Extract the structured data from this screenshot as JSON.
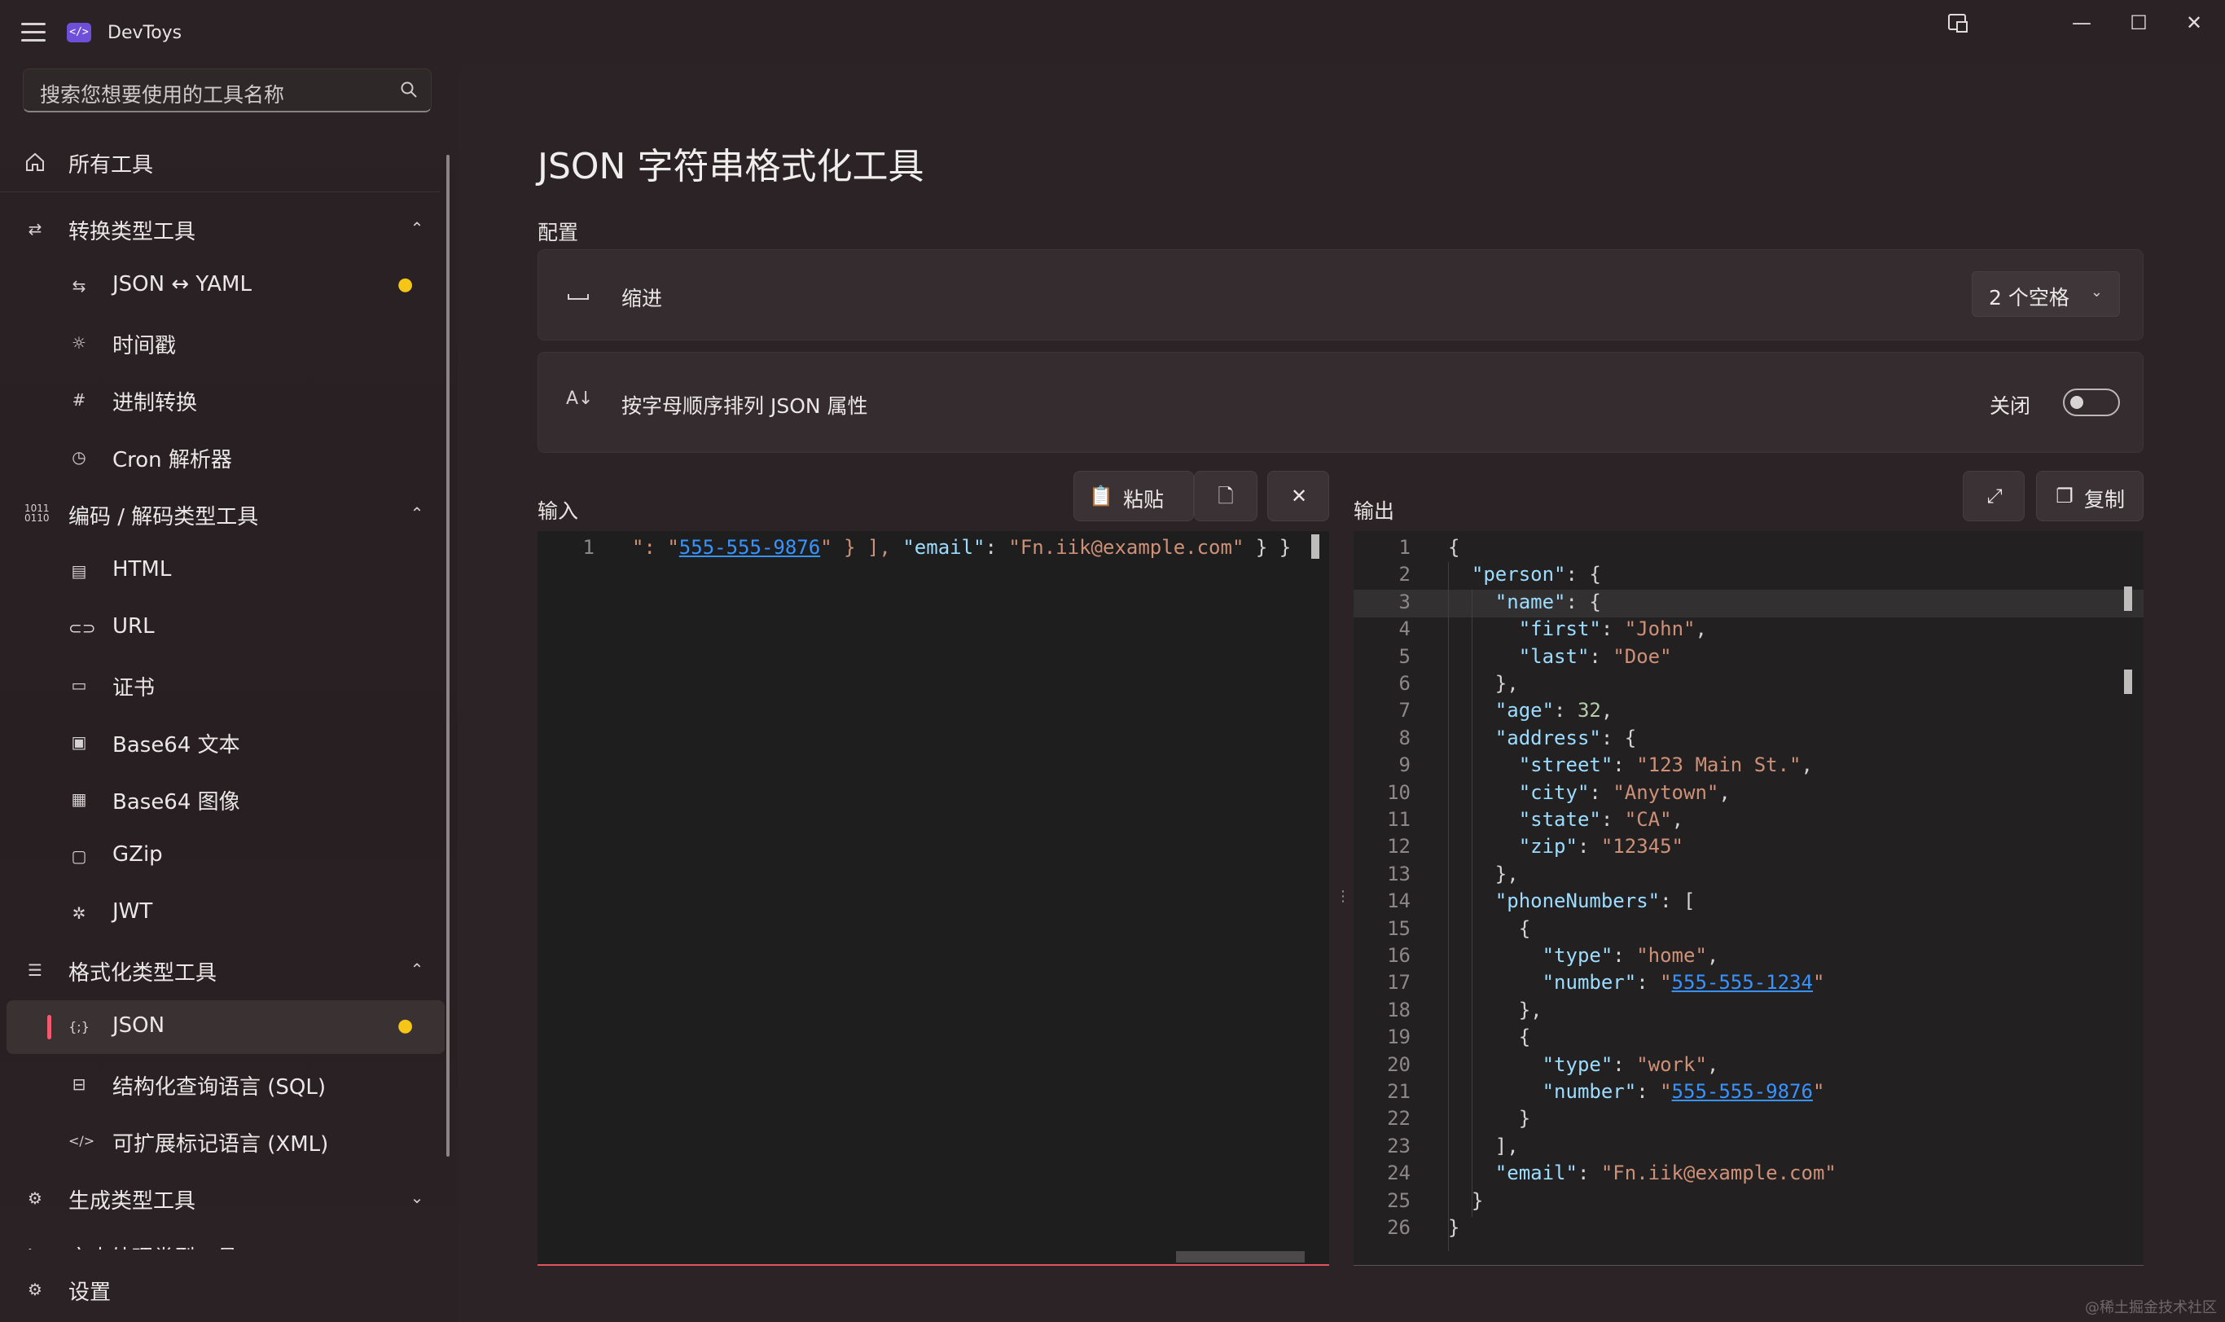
{
  "app": {
    "title": "DevToys",
    "logo_glyph": "</>"
  },
  "window_controls": {
    "snap_icon": "snap-layout-icon",
    "minimize": "—",
    "maximize": "☐",
    "close": "✕"
  },
  "sidebar": {
    "search_placeholder": "搜索您想要使用的工具名称",
    "all_tools": "所有工具",
    "groups": [
      {
        "label": "转换类型工具",
        "expanded": true,
        "items": [
          {
            "label": "JSON ↔ YAML",
            "badge": "bulb"
          },
          {
            "label": "时间戳"
          },
          {
            "label": "进制转换"
          },
          {
            "label": "Cron 解析器"
          }
        ]
      },
      {
        "label": "编码 / 解码类型工具",
        "expanded": true,
        "items": [
          {
            "label": "HTML"
          },
          {
            "label": "URL"
          },
          {
            "label": "证书"
          },
          {
            "label": "Base64 文本"
          },
          {
            "label": "Base64 图像"
          },
          {
            "label": "GZip"
          },
          {
            "label": "JWT"
          }
        ]
      },
      {
        "label": "格式化类型工具",
        "expanded": true,
        "items": [
          {
            "label": "JSON",
            "badge": "bulb",
            "selected": true
          },
          {
            "label": "结构化查询语言 (SQL)"
          },
          {
            "label": "可扩展标记语言 (XML)"
          }
        ]
      },
      {
        "label": "生成类型工具",
        "expanded": false
      },
      {
        "label": "文本处理类型工具",
        "expanded": false
      }
    ],
    "settings": "设置"
  },
  "page": {
    "title": "JSON 字符串格式化工具",
    "config_label": "配置",
    "indent": {
      "label": "缩进",
      "value": "2 个空格"
    },
    "sort": {
      "label": "按字母顺序排列 JSON 属性",
      "state_label": "关闭",
      "on": false
    }
  },
  "input": {
    "label": "输入",
    "paste_label": "粘贴",
    "line_number": "1",
    "line_text_1": "\": \"",
    "line_url": "555-555-9876",
    "line_text_2": "\" } ], ",
    "line_key": "\"email\"",
    "line_text_3": ": ",
    "line_value": "\"Fn.iik@example.com\"",
    "line_text_4": " } }"
  },
  "output": {
    "label": "输出",
    "copy_label": "复制",
    "lines": [
      [
        {
          "t": "{",
          "c": "p"
        }
      ],
      [
        {
          "t": "  ",
          "c": "p"
        },
        {
          "t": "\"person\"",
          "c": "k"
        },
        {
          "t": ": {",
          "c": "p"
        }
      ],
      [
        {
          "t": "    ",
          "c": "p"
        },
        {
          "t": "\"name\"",
          "c": "k"
        },
        {
          "t": ": {",
          "c": "p"
        }
      ],
      [
        {
          "t": "      ",
          "c": "p"
        },
        {
          "t": "\"first\"",
          "c": "k"
        },
        {
          "t": ": ",
          "c": "p"
        },
        {
          "t": "\"John\"",
          "c": "s"
        },
        {
          "t": ",",
          "c": "p"
        }
      ],
      [
        {
          "t": "      ",
          "c": "p"
        },
        {
          "t": "\"last\"",
          "c": "k"
        },
        {
          "t": ": ",
          "c": "p"
        },
        {
          "t": "\"Doe\"",
          "c": "s"
        }
      ],
      [
        {
          "t": "    },",
          "c": "p"
        }
      ],
      [
        {
          "t": "    ",
          "c": "p"
        },
        {
          "t": "\"age\"",
          "c": "k"
        },
        {
          "t": ": ",
          "c": "p"
        },
        {
          "t": "32",
          "c": "n"
        },
        {
          "t": ",",
          "c": "p"
        }
      ],
      [
        {
          "t": "    ",
          "c": "p"
        },
        {
          "t": "\"address\"",
          "c": "k"
        },
        {
          "t": ": {",
          "c": "p"
        }
      ],
      [
        {
          "t": "      ",
          "c": "p"
        },
        {
          "t": "\"street\"",
          "c": "k"
        },
        {
          "t": ": ",
          "c": "p"
        },
        {
          "t": "\"123 Main St.\"",
          "c": "s"
        },
        {
          "t": ",",
          "c": "p"
        }
      ],
      [
        {
          "t": "      ",
          "c": "p"
        },
        {
          "t": "\"city\"",
          "c": "k"
        },
        {
          "t": ": ",
          "c": "p"
        },
        {
          "t": "\"Anytown\"",
          "c": "s"
        },
        {
          "t": ",",
          "c": "p"
        }
      ],
      [
        {
          "t": "      ",
          "c": "p"
        },
        {
          "t": "\"state\"",
          "c": "k"
        },
        {
          "t": ": ",
          "c": "p"
        },
        {
          "t": "\"CA\"",
          "c": "s"
        },
        {
          "t": ",",
          "c": "p"
        }
      ],
      [
        {
          "t": "      ",
          "c": "p"
        },
        {
          "t": "\"zip\"",
          "c": "k"
        },
        {
          "t": ": ",
          "c": "p"
        },
        {
          "t": "\"12345\"",
          "c": "s"
        }
      ],
      [
        {
          "t": "    },",
          "c": "p"
        }
      ],
      [
        {
          "t": "    ",
          "c": "p"
        },
        {
          "t": "\"phoneNumbers\"",
          "c": "k"
        },
        {
          "t": ": [",
          "c": "p"
        }
      ],
      [
        {
          "t": "      {",
          "c": "p"
        }
      ],
      [
        {
          "t": "        ",
          "c": "p"
        },
        {
          "t": "\"type\"",
          "c": "k"
        },
        {
          "t": ": ",
          "c": "p"
        },
        {
          "t": "\"home\"",
          "c": "s"
        },
        {
          "t": ",",
          "c": "p"
        }
      ],
      [
        {
          "t": "        ",
          "c": "p"
        },
        {
          "t": "\"number\"",
          "c": "k"
        },
        {
          "t": ": ",
          "c": "p"
        },
        {
          "t": "\"",
          "c": "s"
        },
        {
          "t": "555-555-1234",
          "c": "u"
        },
        {
          "t": "\"",
          "c": "s"
        }
      ],
      [
        {
          "t": "      },",
          "c": "p"
        }
      ],
      [
        {
          "t": "      {",
          "c": "p"
        }
      ],
      [
        {
          "t": "        ",
          "c": "p"
        },
        {
          "t": "\"type\"",
          "c": "k"
        },
        {
          "t": ": ",
          "c": "p"
        },
        {
          "t": "\"work\"",
          "c": "s"
        },
        {
          "t": ",",
          "c": "p"
        }
      ],
      [
        {
          "t": "        ",
          "c": "p"
        },
        {
          "t": "\"number\"",
          "c": "k"
        },
        {
          "t": ": ",
          "c": "p"
        },
        {
          "t": "\"",
          "c": "s"
        },
        {
          "t": "555-555-9876",
          "c": "u"
        },
        {
          "t": "\"",
          "c": "s"
        }
      ],
      [
        {
          "t": "      }",
          "c": "p"
        }
      ],
      [
        {
          "t": "    ],",
          "c": "p"
        }
      ],
      [
        {
          "t": "    ",
          "c": "p"
        },
        {
          "t": "\"email\"",
          "c": "k"
        },
        {
          "t": ": ",
          "c": "p"
        },
        {
          "t": "\"Fn.iik@example.com\"",
          "c": "s"
        }
      ],
      [
        {
          "t": "  }",
          "c": "p"
        }
      ],
      [
        {
          "t": "}",
          "c": "p"
        }
      ]
    ]
  },
  "watermark": "@稀土掘金技术社区",
  "colors": {
    "accent": "#f25a6d",
    "bulb": "#f5c518",
    "json_key": "#9cdcfe",
    "json_string": "#ce9178",
    "json_number": "#b5cea8",
    "link": "#3794ff"
  }
}
